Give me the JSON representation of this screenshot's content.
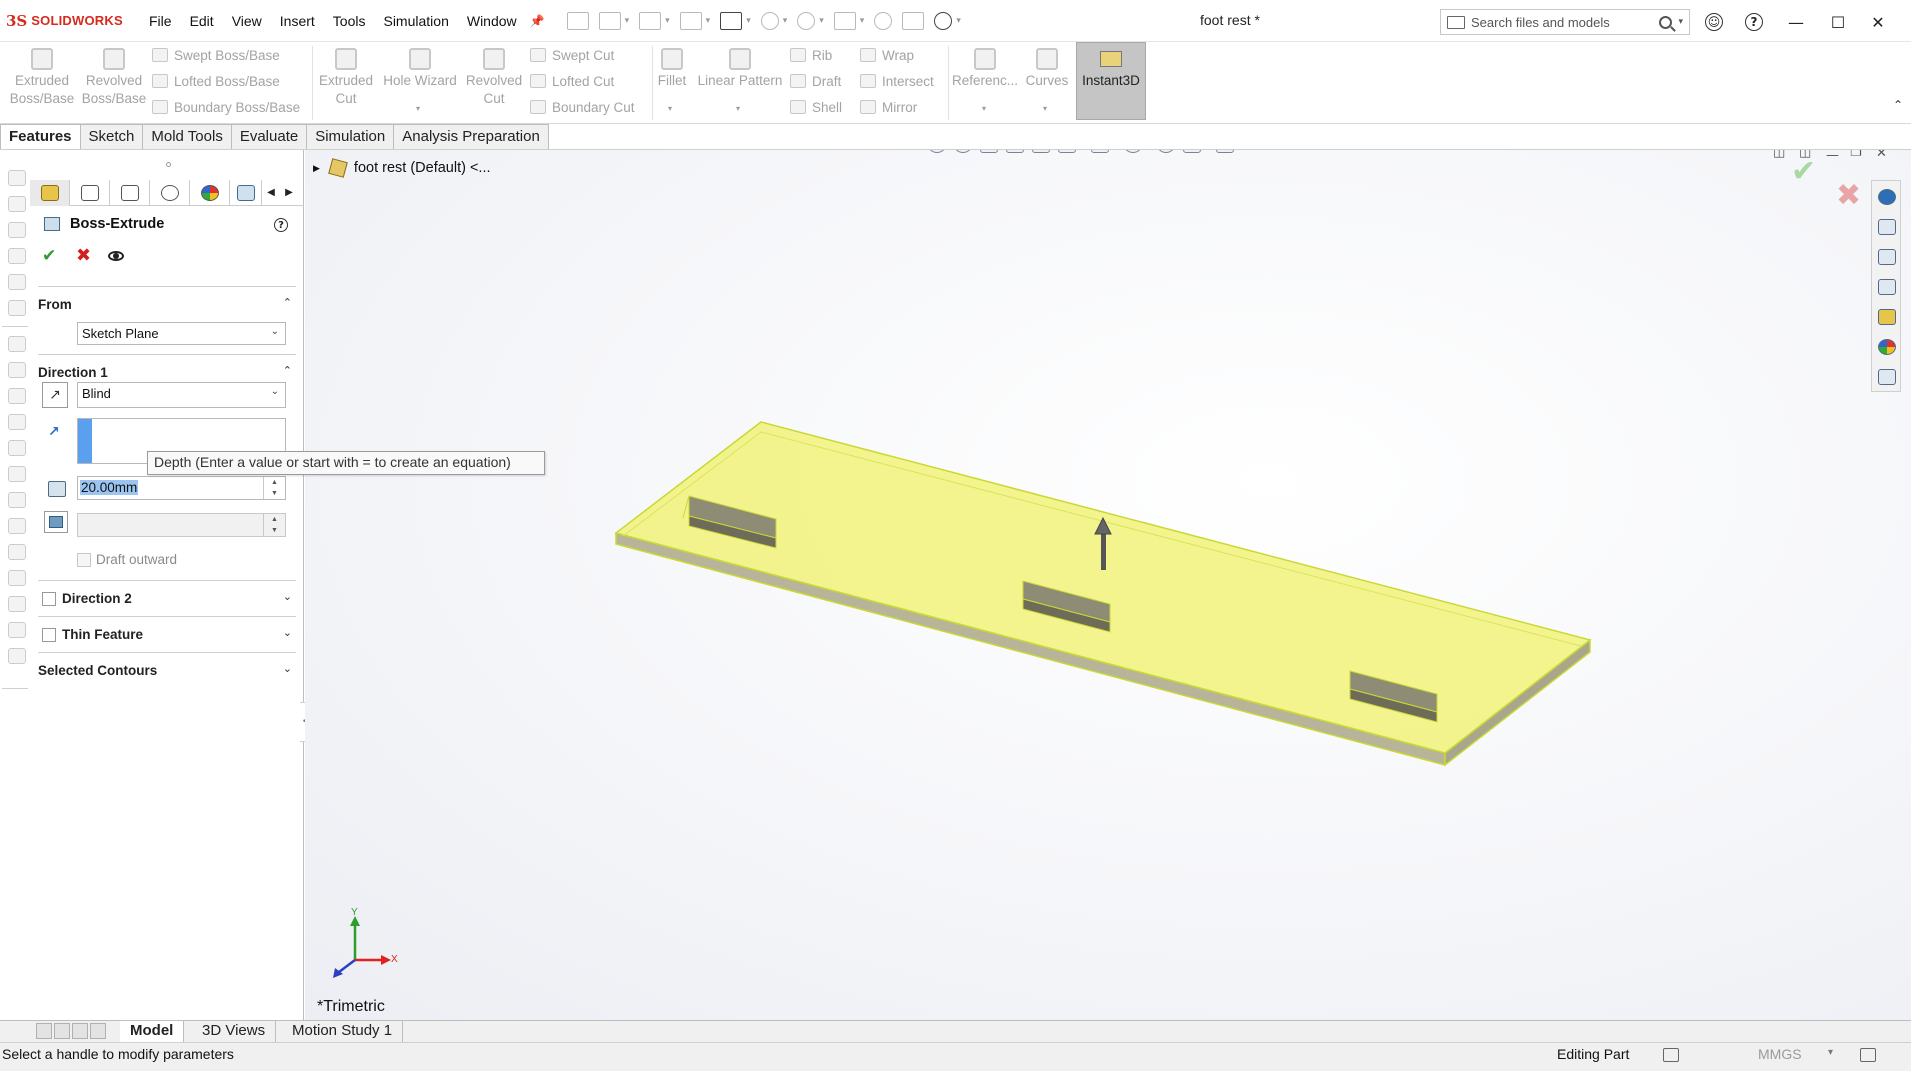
{
  "app": {
    "logo_mark": "3S",
    "logo_text": "SOLIDWORKS",
    "document_title": "foot rest *",
    "menu": [
      "File",
      "Edit",
      "View",
      "Insert",
      "Tools",
      "Simulation",
      "Window"
    ],
    "search_placeholder": "Search files and models"
  },
  "ribbon": {
    "extruded_boss": [
      "Extruded",
      "Boss/Base"
    ],
    "revolved_boss": [
      "Revolved",
      "Boss/Base"
    ],
    "swept_boss": "Swept Boss/Base",
    "lofted_boss": "Lofted Boss/Base",
    "boundary_boss": "Boundary Boss/Base",
    "extruded_cut": [
      "Extruded",
      "Cut"
    ],
    "hole_wizard": "Hole Wizard",
    "revolved_cut": [
      "Revolved",
      "Cut"
    ],
    "swept_cut": "Swept Cut",
    "lofted_cut": "Lofted Cut",
    "boundary_cut": "Boundary Cut",
    "fillet": "Fillet",
    "linear_pattern": "Linear Pattern",
    "rib": "Rib",
    "draft": "Draft",
    "shell": "Shell",
    "wrap": "Wrap",
    "intersect": "Intersect",
    "mirror": "Mirror",
    "reference": "Referenc...",
    "curves": "Curves",
    "instant3d": "Instant3D"
  },
  "tabs": [
    {
      "label": "Features",
      "active": true
    },
    {
      "label": "Sketch",
      "active": false
    },
    {
      "label": "Mold Tools",
      "active": false
    },
    {
      "label": "Evaluate",
      "active": false
    },
    {
      "label": "Simulation",
      "active": false
    },
    {
      "label": "Analysis Preparation",
      "active": false
    }
  ],
  "property_manager": {
    "title": "Boss-Extrude",
    "help": "?",
    "from": {
      "header": "From",
      "value": "Sketch Plane"
    },
    "direction1": {
      "header": "Direction 1",
      "end_condition": "Blind",
      "depth": "20.00mm",
      "depth_tooltip": "Depth (Enter a value or start with = to create an equation)",
      "draft_value": "",
      "draft_outward": "Draft outward"
    },
    "direction2": {
      "header": "Direction 2"
    },
    "thin_feature": {
      "header": "Thin Feature"
    },
    "selected_contours": {
      "header": "Selected Contours"
    }
  },
  "graphics": {
    "tree_root": "foot rest  (Default) <...",
    "view_name": "*Trimetric",
    "axis_x": "X",
    "axis_y": "Y",
    "part_color": "#f2f27a",
    "edge_color": "#c9d934",
    "side_color": "#b7b49a"
  },
  "bottom_tabs": [
    {
      "label": "Model",
      "active": true
    },
    {
      "label": "3D Views",
      "active": false
    },
    {
      "label": "Motion Study 1",
      "active": false
    }
  ],
  "status": {
    "message": "Select a handle to modify parameters",
    "mode": "Editing Part",
    "units": "MMGS"
  }
}
